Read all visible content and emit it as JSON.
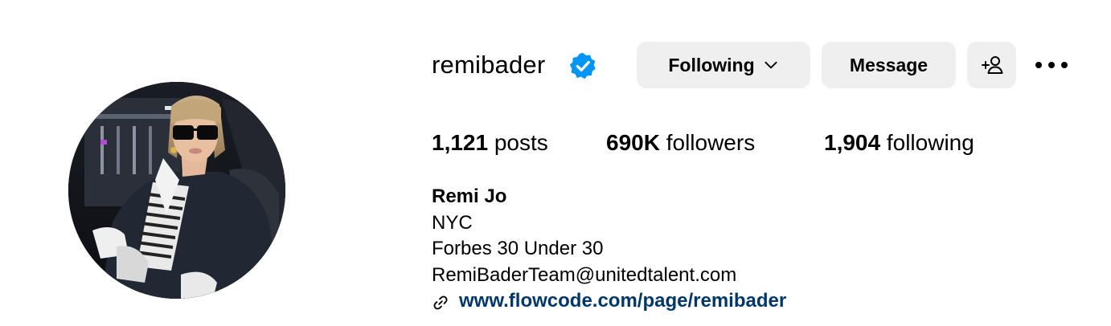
{
  "profile": {
    "username": "remibader",
    "verified": true,
    "avatar_alt": "remibader profile picture"
  },
  "actions": {
    "following_label": "Following",
    "message_label": "Message"
  },
  "icons": {
    "verified": "verified-badge-icon",
    "chevron": "chevron-down-icon",
    "add_user": "add-user-icon",
    "more": "more-options-icon",
    "link": "link-icon"
  },
  "stats": {
    "posts_count": "1,121",
    "posts_label": "posts",
    "followers_count": "690K",
    "followers_label": "followers",
    "following_count": "1,904",
    "following_label": "following"
  },
  "bio": {
    "name": "Remi Jo",
    "lines": [
      "NYC",
      "Forbes 30 Under 30",
      "RemiBaderTeam@unitedtalent.com"
    ],
    "link": "www.flowcode.com/page/remibader"
  },
  "colors": {
    "verified_blue": "#0095f6",
    "button_bg": "#efefef",
    "link": "#00376b"
  }
}
